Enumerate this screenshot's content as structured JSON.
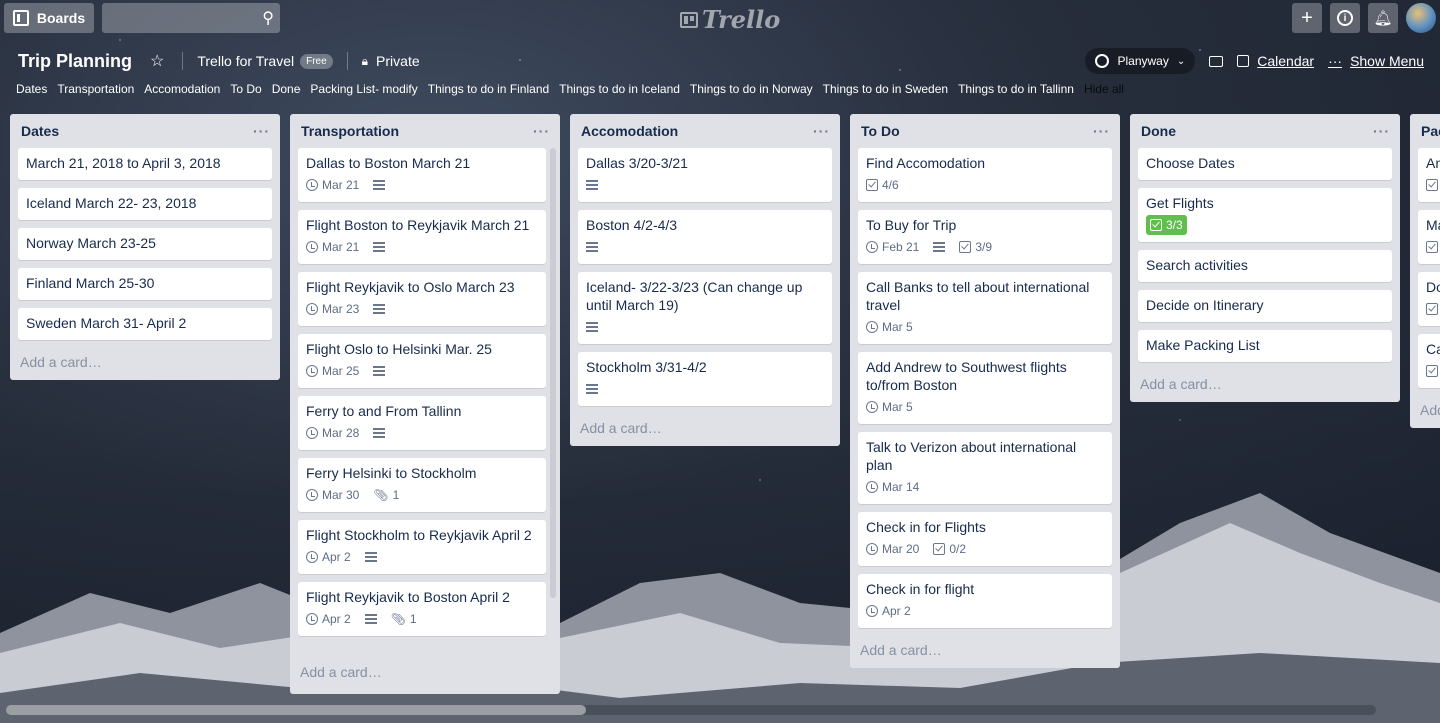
{
  "topbar": {
    "boards_label": "Boards",
    "search_placeholder": "",
    "logo": "Trello"
  },
  "board": {
    "title": "Trip Planning",
    "team": "Trello for Travel",
    "team_badge": "Free",
    "visibility": "Private",
    "planyway": "Planyway",
    "calendar": "Calendar",
    "show_menu": "Show Menu"
  },
  "filters": [
    "Dates",
    "Transportation",
    "Accomodation",
    "To Do",
    "Done",
    "Packing List- modify",
    "Things to do in Finland",
    "Things to do in Iceland",
    "Things to do in Norway",
    "Things to do in Sweden",
    "Things to do in Tallinn",
    "Hide all"
  ],
  "lists": [
    {
      "title": "Dates",
      "add": "Add a card…",
      "cards": [
        {
          "title": "March 21, 2018 to April 3, 2018"
        },
        {
          "title": "Iceland March 22- 23, 2018"
        },
        {
          "title": "Norway March 23-25"
        },
        {
          "title": "Finland March 25-30"
        },
        {
          "title": "Sweden March 31- April 2"
        }
      ]
    },
    {
      "title": "Transportation",
      "add": "Add a card…",
      "cards": [
        {
          "title": "Dallas to Boston March 21",
          "due": "Mar 21"
        },
        {
          "title": "Flight Boston to Reykjavik March 21",
          "due": "Mar 21"
        },
        {
          "title": "Flight Reykjavik to Oslo March 23",
          "due": "Mar 23"
        },
        {
          "title": "Flight Oslo to Helsinki Mar. 25",
          "due": "Mar 25"
        },
        {
          "title": "Ferry to and From Tallinn",
          "due": "Mar 28"
        },
        {
          "title": "Ferry Helsinki to Stockholm",
          "due": "Mar 30",
          "attachments": "1"
        },
        {
          "title": "Flight Stockholm to Reykjavik April 2",
          "due": "Apr 2"
        },
        {
          "title": "Flight Reykjavik to Boston April 2",
          "due": "Apr 2",
          "attachments": "1"
        }
      ]
    },
    {
      "title": "Accomodation",
      "add": "Add a card…",
      "cards": [
        {
          "title": "Dallas 3/20-3/21"
        },
        {
          "title": "Boston 4/2-4/3"
        },
        {
          "title": "Iceland- 3/22-3/23 (Can change up until March 19)"
        },
        {
          "title": "Stockholm 3/31-4/2"
        }
      ]
    },
    {
      "title": "To Do",
      "add": "Add a card…",
      "cards": [
        {
          "title": "Find Accomodation",
          "checklist": "4/6"
        },
        {
          "title": "To Buy for Trip",
          "due": "Feb 21",
          "checklist": "3/9"
        },
        {
          "title": "Call Banks to tell about international travel",
          "due": "Mar 5"
        },
        {
          "title": "Add Andrew to Southwest flights to/from Boston",
          "due": "Mar 5"
        },
        {
          "title": "Talk to Verizon about international plan",
          "due": "Mar 14"
        },
        {
          "title": "Check in for Flights",
          "due": "Mar 20",
          "checklist": "0/2"
        },
        {
          "title": "Check in for flight",
          "due": "Apr 2"
        }
      ]
    },
    {
      "title": "Done",
      "add": "Add a card…",
      "cards": [
        {
          "title": "Choose Dates"
        },
        {
          "title": "Get Flights",
          "checklist": "3/3"
        },
        {
          "title": "Search activities"
        },
        {
          "title": "Decide on Itinerary"
        },
        {
          "title": "Make Packing List"
        }
      ]
    },
    {
      "title": "Pac",
      "add": "Add",
      "cards": [
        {
          "title": "An"
        },
        {
          "title": "Ma"
        },
        {
          "title": "Do"
        },
        {
          "title": "Ca"
        }
      ]
    }
  ]
}
